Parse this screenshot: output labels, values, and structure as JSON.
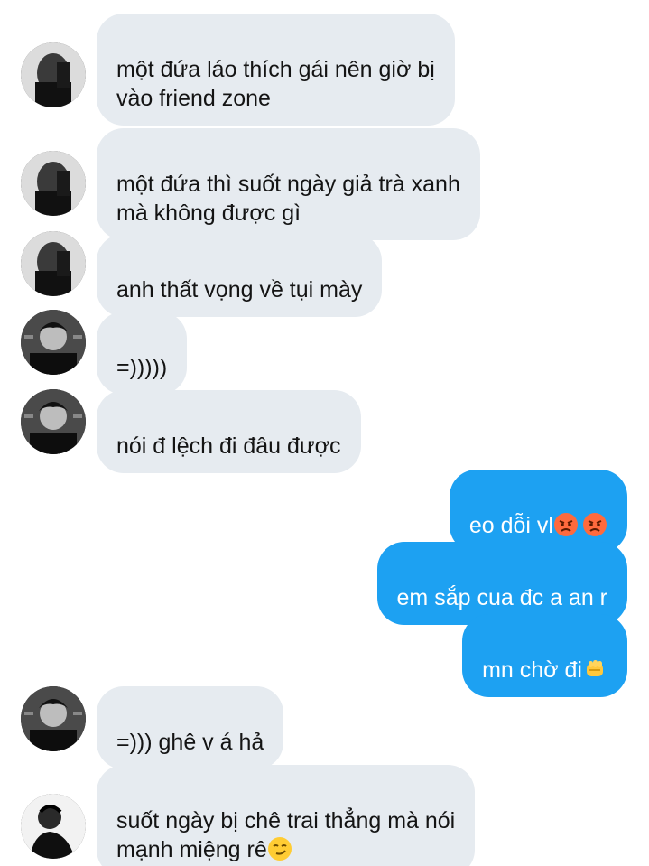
{
  "messages": [
    {
      "side": "in",
      "avatar": "avatar-user-a",
      "text": "một đứa láo thích gái nên giờ bị\nvào friend zone"
    },
    {
      "side": "in",
      "avatar": "avatar-user-a",
      "text": "một đứa thì suốt ngày giả trà xanh\nmà không được gì"
    },
    {
      "side": "in",
      "avatar": "avatar-user-a",
      "text": "anh thất vọng về tụi mày"
    },
    {
      "side": "in",
      "avatar": "avatar-user-b",
      "text": "=)))))"
    },
    {
      "side": "in",
      "avatar": "avatar-user-b",
      "text": "nói đ lệch đi đâu được"
    },
    {
      "side": "out",
      "text": "eo dỗi vl",
      "emojis": [
        "angry-face-emoji",
        "angry-face-emoji"
      ]
    },
    {
      "side": "out",
      "text": "em sắp cua đc a an r"
    },
    {
      "side": "out",
      "text": "mn chờ đi",
      "emojis": [
        "fist-emoji"
      ]
    },
    {
      "side": "in",
      "avatar": "avatar-user-b",
      "text": "=))) ghê v á hả"
    },
    {
      "side": "in",
      "avatar": "avatar-user-c",
      "text": "suốt ngày bị chê trai thẳng mà nói\nmạnh miệng rê",
      "emojis": [
        "smirk-face-emoji"
      ]
    }
  ],
  "colors": {
    "incoming_bubble": "#e6ebf0",
    "outgoing_bubble": "#1da1f2",
    "incoming_text": "#141414",
    "outgoing_text": "#ffffff"
  }
}
